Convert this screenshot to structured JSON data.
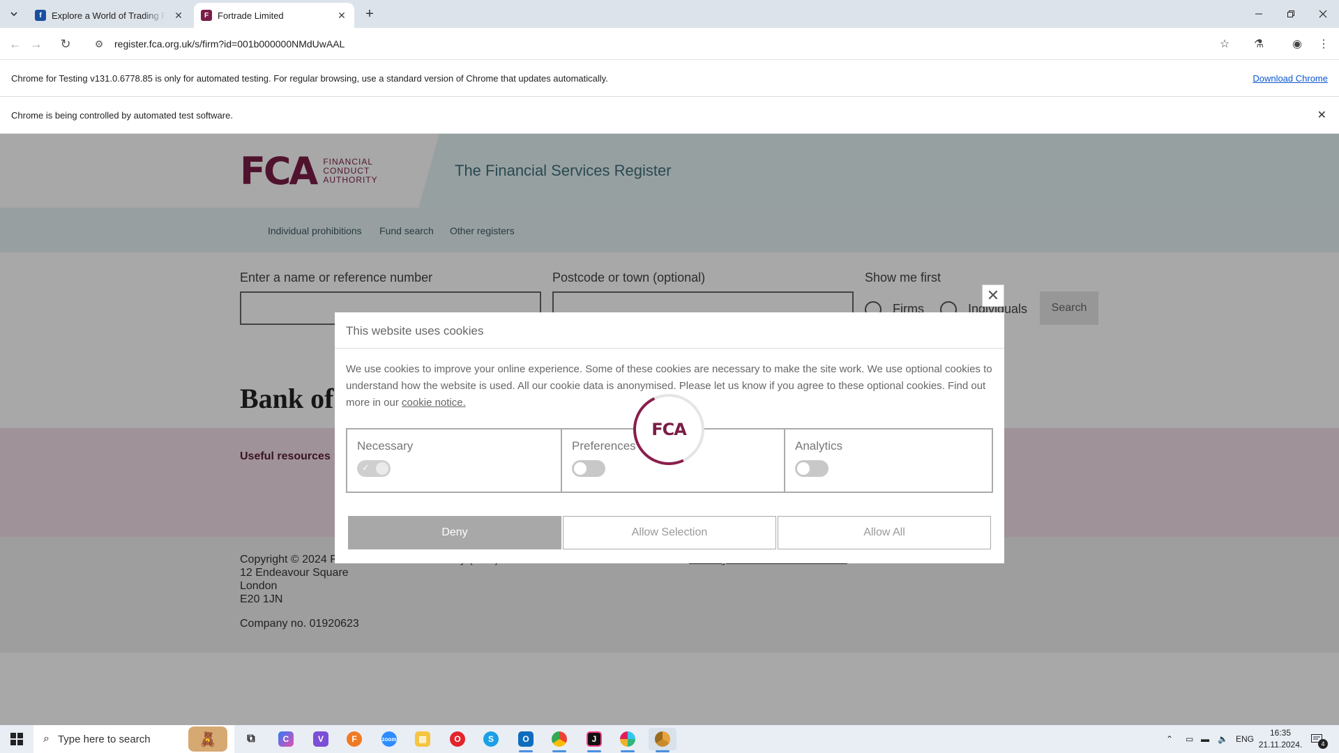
{
  "browser": {
    "tabs": [
      {
        "title": "Explore a World of Trading Possibilities",
        "favicon": "trading-favicon",
        "active": false
      },
      {
        "title": "Fortrade Limited",
        "favicon": "fca-favicon",
        "active": true
      }
    ],
    "url": "register.fca.org.uk/s/firm?id=001b000000NMdUwAAL",
    "infobar_testing": "Chrome for Testing v131.0.6778.85 is only for automated testing. For regular browsing, use a standard version of Chrome that updates automatically.",
    "infobar_download": "Download Chrome",
    "infobar_automation": "Chrome is being controlled by automated test software."
  },
  "page": {
    "logo_mark": "FCA",
    "logo_words": [
      "FINANCIAL",
      "CONDUCT",
      "AUTHORITY"
    ],
    "register_title": "The Financial Services Register",
    "nav": [
      "Individual prohibitions",
      "Fund search",
      "Other registers"
    ],
    "search": {
      "name_label": "Enter a name or reference number",
      "postcode_label": "Postcode or town (optional)",
      "show_me_first": "Show me first",
      "radio_firms": "Firms",
      "radio_individuals": "Individuals",
      "search_button": "Search"
    },
    "boe_text": "Bank of",
    "useful_resources": "Useful resources",
    "footer": {
      "copyright": "Copyright © 2024 Financial Conduct Authority (FCA)",
      "address1": "12 Endeavour Square",
      "address2": "London",
      "postcode": "E20 1JN",
      "company_no": "Company no. 01920623",
      "share_link": "Share your screen with the FCA"
    }
  },
  "cookie_dialog": {
    "title": "This website uses cookies",
    "body": "We use cookies to improve your online experience. Some of these cookies are necessary to make the site work. We use optional cookies to understand how the website is used. All our cookie data is anonymised. Please let us know if you agree to these optional cookies. Find out more in our ",
    "notice_link": "cookie notice.",
    "categories": [
      {
        "name": "Necessary",
        "enabled": true
      },
      {
        "name": "Preferences",
        "enabled": false
      },
      {
        "name": "Analytics",
        "enabled": false
      }
    ],
    "buttons": {
      "deny": "Deny",
      "allow_selection": "Allow Selection",
      "allow_all": "Allow All"
    },
    "close_glyph": "✕"
  },
  "spinner_logo": "FCA",
  "taskbar": {
    "search_placeholder": "Type here to search",
    "apps": [
      "task-view",
      "copilot",
      "visual-studio",
      "firefox",
      "zoom",
      "file-explorer",
      "opera",
      "skype",
      "outlook",
      "chrome",
      "jetbrains",
      "slack",
      "chrome-testing"
    ],
    "language": "ENG",
    "time": "16:35",
    "date": "21.11.2024.",
    "notifications": "4"
  },
  "colors": {
    "fca_brand": "#7a1e47",
    "link_blue": "#0b57d0",
    "deny_button": "#a8a8a8"
  }
}
